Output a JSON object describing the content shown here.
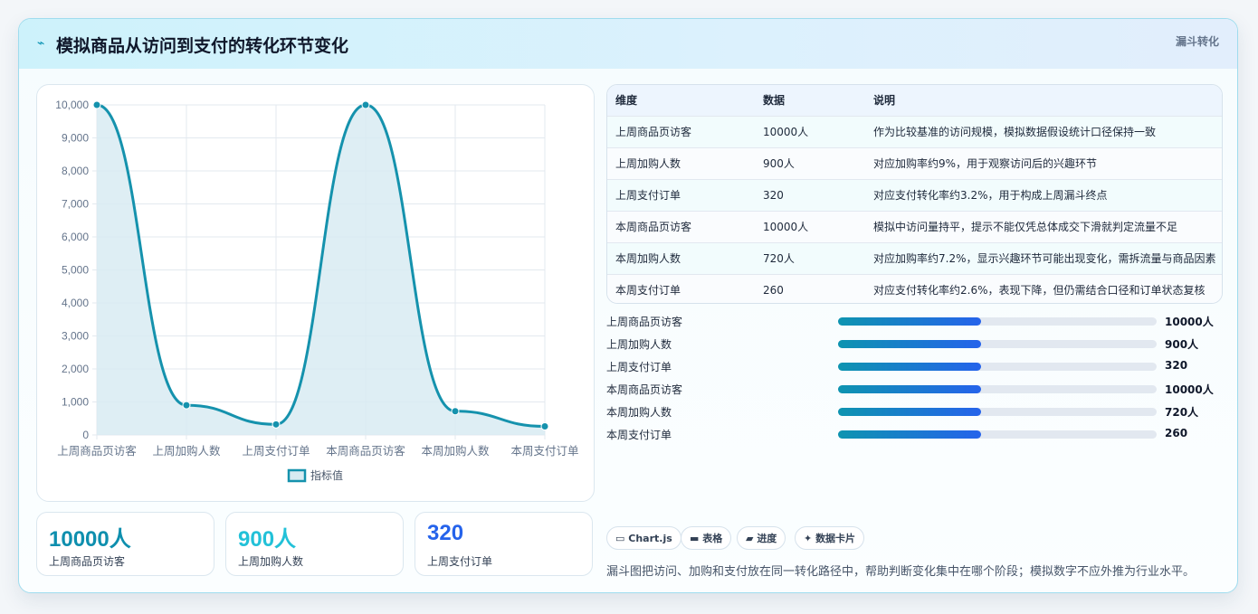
{
  "header": {
    "icon": "chart-line-icon",
    "title": "模拟商品从访问到支付的转化环节变化",
    "tag": "漏斗转化"
  },
  "chart_data": {
    "type": "area",
    "categories": [
      "上周商品页访客",
      "上周加购人数",
      "上周支付订单",
      "本周商品页访客",
      "本周加购人数",
      "本周支付订单"
    ],
    "series": [
      {
        "name": "指标值",
        "values": [
          10000,
          900,
          320,
          10000,
          720,
          260
        ]
      }
    ],
    "ylim": [
      0,
      10000
    ],
    "yticks": [
      "10,000",
      "9,000",
      "8,000",
      "7,000",
      "6,000",
      "5,000",
      "4,000",
      "3,000",
      "2,000",
      "1,000",
      "0"
    ],
    "grid": true,
    "legend": "bottom",
    "color": "#1592ad",
    "fill": "#d8ebf2"
  },
  "stats": [
    {
      "value": "10000人",
      "label": "上周商品页访客",
      "color": "#0e8fae"
    },
    {
      "value": "900人",
      "label": "上周加购人数",
      "color": "#22c1d8"
    },
    {
      "value": "320",
      "label": "上周支付订单",
      "color": "#2563eb"
    }
  ],
  "table": {
    "headers": [
      "维度",
      "数据",
      "说明"
    ],
    "rows": [
      [
        "上周商品页访客",
        "10000人",
        "作为比较基准的访问规模，模拟数据假设统计口径保持一致"
      ],
      [
        "上周加购人数",
        "900人",
        "对应加购率约9%，用于观察访问后的兴趣环节"
      ],
      [
        "上周支付订单",
        "320",
        "对应支付转化率约3.2%，用于构成上周漏斗终点"
      ],
      [
        "本周商品页访客",
        "10000人",
        "模拟中访问量持平，提示不能仅凭总体成交下滑就判定流量不足"
      ],
      [
        "本周加购人数",
        "720人",
        "对应加购率约7.2%，显示兴趣环节可能出现变化，需拆流量与商品因素"
      ],
      [
        "本周支付订单",
        "260",
        "对应支付转化率约2.6%，表现下降，但仍需结合口径和订单状态复核"
      ]
    ]
  },
  "progress": [
    {
      "label": "上周商品页访客",
      "value": "10000人",
      "fraction": 0.45
    },
    {
      "label": "上周加购人数",
      "value": "900人",
      "fraction": 0.45
    },
    {
      "label": "上周支付订单",
      "value": "320",
      "fraction": 0.45
    },
    {
      "label": "本周商品页访客",
      "value": "10000人",
      "fraction": 0.45
    },
    {
      "label": "本周加购人数",
      "value": "720人",
      "fraction": 0.45
    },
    {
      "label": "本周支付订单",
      "value": "260",
      "fraction": 0.45
    }
  ],
  "chips": [
    {
      "icon": "monitor-icon",
      "glyph": "▭",
      "label": "Chart.js"
    },
    {
      "icon": "table-icon",
      "glyph": "▬",
      "label": "表格"
    },
    {
      "icon": "folder-icon",
      "glyph": "▰",
      "label": "进度"
    },
    {
      "icon": "sparkle-icon",
      "glyph": "✦",
      "label": "数据卡片"
    }
  ],
  "note": "漏斗图把访问、加购和支付放在同一转化路径中，帮助判断变化集中在哪个阶段；模拟数字不应外推为行业水平。"
}
